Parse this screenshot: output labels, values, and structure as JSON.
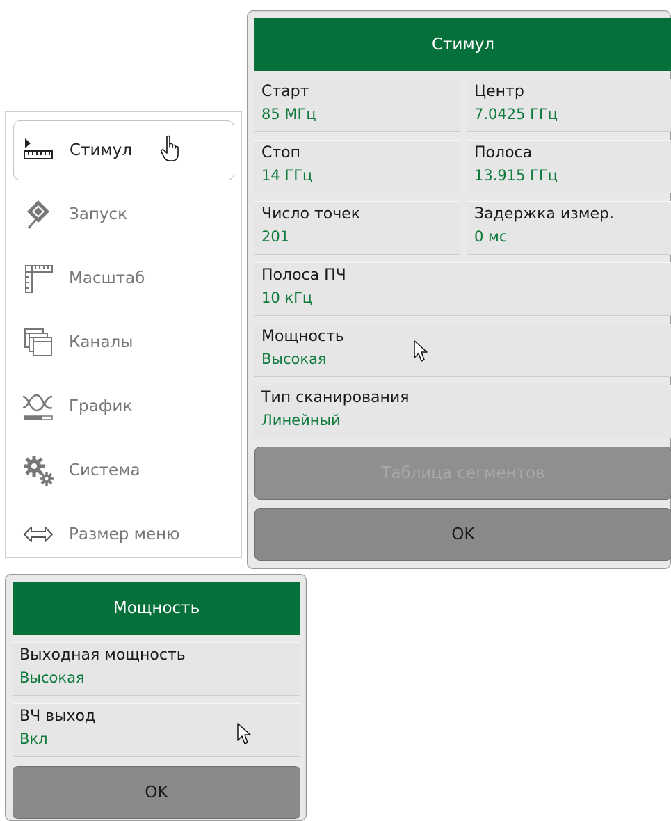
{
  "menu": {
    "items": [
      {
        "label": "Стимул",
        "icon": "ruler-play-icon"
      },
      {
        "label": "Запуск",
        "icon": "trigger-icon"
      },
      {
        "label": "Масштаб",
        "icon": "scale-ruler-icon"
      },
      {
        "label": "Каналы",
        "icon": "channels-icon"
      },
      {
        "label": "График",
        "icon": "trace-icon"
      },
      {
        "label": "Система",
        "icon": "gears-icon"
      },
      {
        "label": "Размер меню",
        "icon": "resize-arrows-icon"
      }
    ]
  },
  "stimulus_panel": {
    "title": "Стимул",
    "start": {
      "label": "Старт",
      "value": "85 МГц"
    },
    "center": {
      "label": "Центр",
      "value": "7.0425 ГГц"
    },
    "stop": {
      "label": "Стоп",
      "value": "14 ГГц"
    },
    "span": {
      "label": "Полоса",
      "value": "13.915 ГГц"
    },
    "points": {
      "label": "Число точек",
      "value": "201"
    },
    "delay": {
      "label": "Задержка измер.",
      "value": "0 мс"
    },
    "ifbw": {
      "label": "Полоса ПЧ",
      "value": "10 кГц"
    },
    "power": {
      "label": "Мощность",
      "value": "Высокая"
    },
    "sweep_type": {
      "label": "Тип сканирования",
      "value": "Линейный"
    },
    "segment_table_label": "Таблица сегментов",
    "ok_label": "OK"
  },
  "power_panel": {
    "title": "Мощность",
    "output_power": {
      "label": "Выходная мощность",
      "value": "Высокая"
    },
    "rf_out": {
      "label": "ВЧ выход",
      "value": "Вкл"
    },
    "ok_label": "OK"
  },
  "colors": {
    "header_green": "#06703a",
    "value_green": "#0e7a3b",
    "button_gray": "#8a8a8a"
  }
}
